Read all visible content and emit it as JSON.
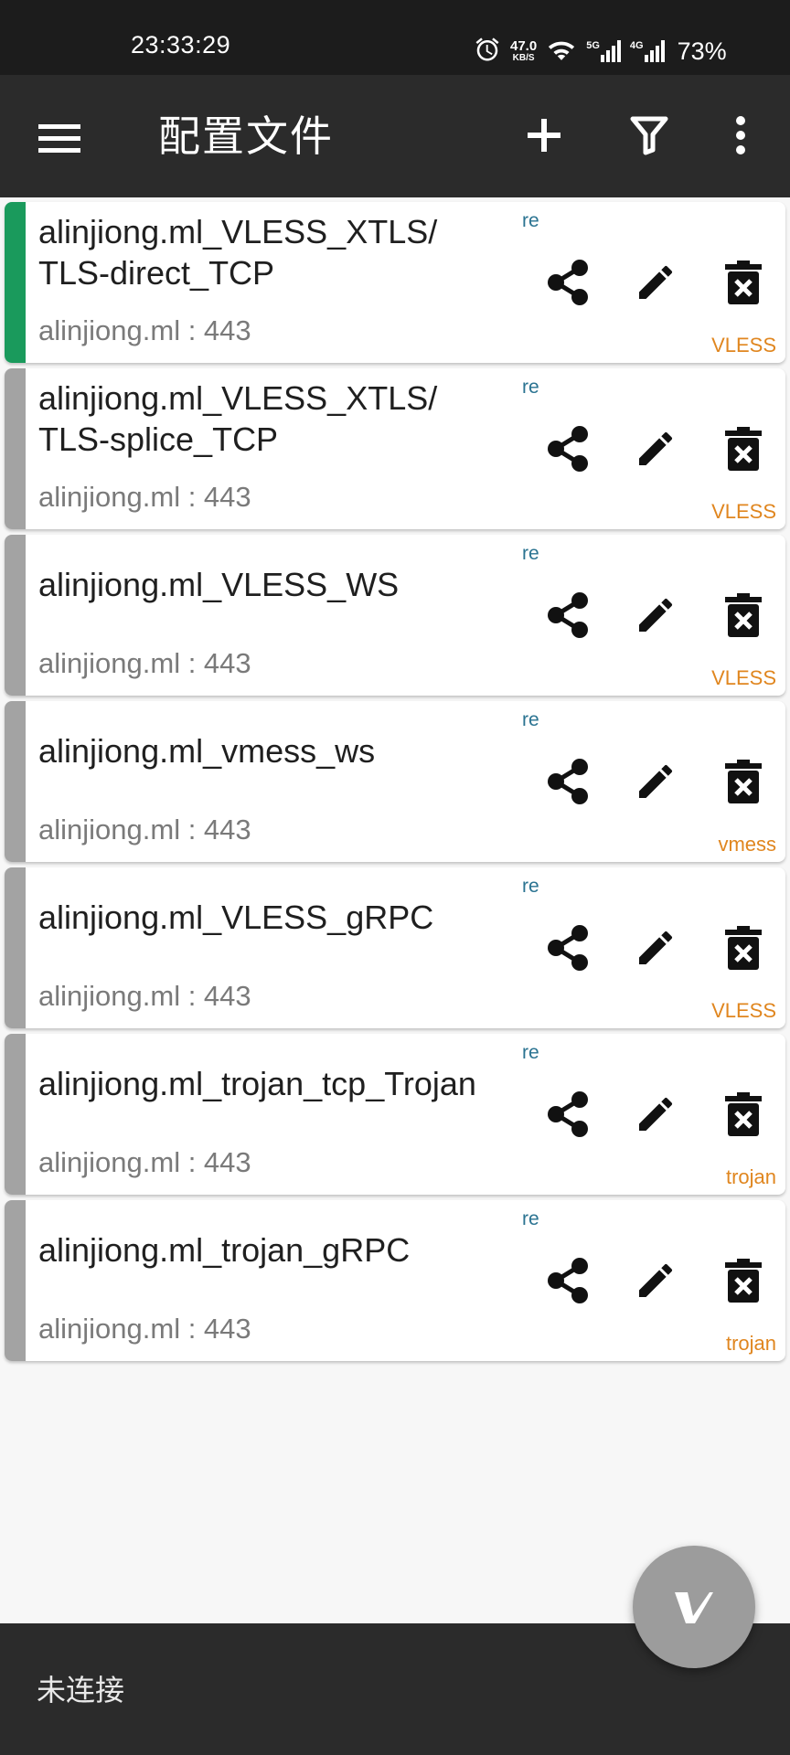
{
  "status_bar": {
    "time": "23:33:29",
    "net_speed_value": "47.0",
    "net_speed_unit": "KB/S",
    "sig1_label": "5G",
    "sig2_label": "4G",
    "battery": "73%"
  },
  "app_bar": {
    "title": "配置文件",
    "icons": [
      "menu-icon",
      "add-icon",
      "filter-icon",
      "more-vert-icon"
    ]
  },
  "servers": [
    {
      "name_line1": "alinjiong.ml_VLESS_XTLS/",
      "name_line2": "TLS-direct_TCP",
      "address": "alinjiong.ml : 443",
      "tag": "re",
      "type": "VLESS",
      "selected": true
    },
    {
      "name_line1": "alinjiong.ml_VLESS_XTLS/",
      "name_line2": "TLS-splice_TCP",
      "address": "alinjiong.ml : 443",
      "tag": "re",
      "type": "VLESS",
      "selected": false
    },
    {
      "name_line1": "alinjiong.ml_VLESS_WS",
      "name_line2": "",
      "address": "alinjiong.ml : 443",
      "tag": "re",
      "type": "VLESS",
      "selected": false
    },
    {
      "name_line1": "alinjiong.ml_vmess_ws",
      "name_line2": "",
      "address": "alinjiong.ml : 443",
      "tag": "re",
      "type": "vmess",
      "selected": false
    },
    {
      "name_line1": "alinjiong.ml_VLESS_gRPC",
      "name_line2": "",
      "address": "alinjiong.ml : 443",
      "tag": "re",
      "type": "VLESS",
      "selected": false
    },
    {
      "name_line1": "alinjiong.ml_trojan_tcp_Trojan",
      "name_line2": "",
      "address": "alinjiong.ml : 443",
      "tag": "re",
      "type": "trojan",
      "selected": false
    },
    {
      "name_line1": "alinjiong.ml_trojan_gRPC",
      "name_line2": "",
      "address": "alinjiong.ml : 443",
      "tag": "re",
      "type": "trojan",
      "selected": false
    }
  ],
  "row_actions": [
    "share-icon",
    "edit-icon",
    "delete-icon"
  ],
  "fab": {
    "icon": "v-logo-icon"
  },
  "bottom_bar": {
    "status": "未连接"
  },
  "colors": {
    "toolbar": "#2b2b2b",
    "selected_indicator": "#1a9a5c",
    "unselected_indicator": "#a3a3a3",
    "tag_color": "#2a7391",
    "type_color": "#e0861f",
    "fab": "#9c9c9c"
  }
}
